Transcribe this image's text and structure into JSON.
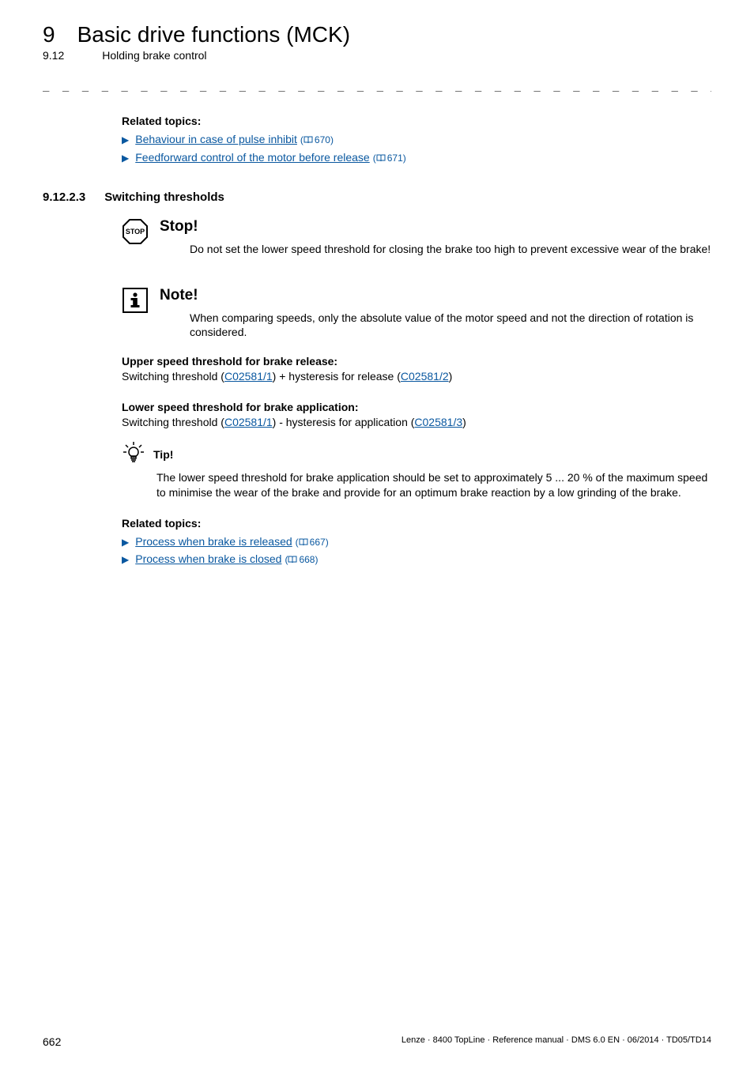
{
  "header": {
    "chapter_number": "9",
    "chapter_title": "Basic drive functions (MCK)",
    "section_number": "9.12",
    "section_title": "Holding brake control"
  },
  "related_top": {
    "heading": "Related topics:",
    "items": [
      {
        "text": "Behaviour in case of pulse inhibit",
        "page": "670"
      },
      {
        "text": "Feedforward control of the motor before release",
        "page": "671"
      }
    ]
  },
  "section": {
    "number": "9.12.2.3",
    "title": "Switching thresholds"
  },
  "stop": {
    "heading": "Stop!",
    "text": "Do not set the lower speed threshold for closing the brake too high to prevent excessive wear of the brake!"
  },
  "note": {
    "heading": "Note!",
    "text": "When comparing speeds, only the absolute value of the motor speed and not the direction of rotation is considered."
  },
  "upper": {
    "heading": "Upper speed threshold for brake release:",
    "prefix": "Switching threshold (",
    "code1": "C02581/1",
    "mid": ") + hysteresis for release (",
    "code2": "C02581/2",
    "suffix": ")"
  },
  "lower": {
    "heading": "Lower speed threshold for brake application:",
    "prefix": "Switching threshold (",
    "code1": "C02581/1",
    "mid": ") - hysteresis for application (",
    "code2": "C02581/3",
    "suffix": ")"
  },
  "tip": {
    "heading": "Tip!",
    "text": "The lower speed threshold for brake application should be set to approximately 5 ... 20 % of the maximum speed to minimise the wear of the brake and provide for an optimum brake reaction by a low grinding of the brake."
  },
  "related_bottom": {
    "heading": "Related topics:",
    "items": [
      {
        "text": "Process when brake is released",
        "page": "667"
      },
      {
        "text": "Process when brake is closed",
        "page": "668"
      }
    ]
  },
  "footer": {
    "page": "662",
    "meta": "Lenze · 8400 TopLine · Reference manual · DMS 6.0 EN · 06/2014 · TD05/TD14"
  }
}
